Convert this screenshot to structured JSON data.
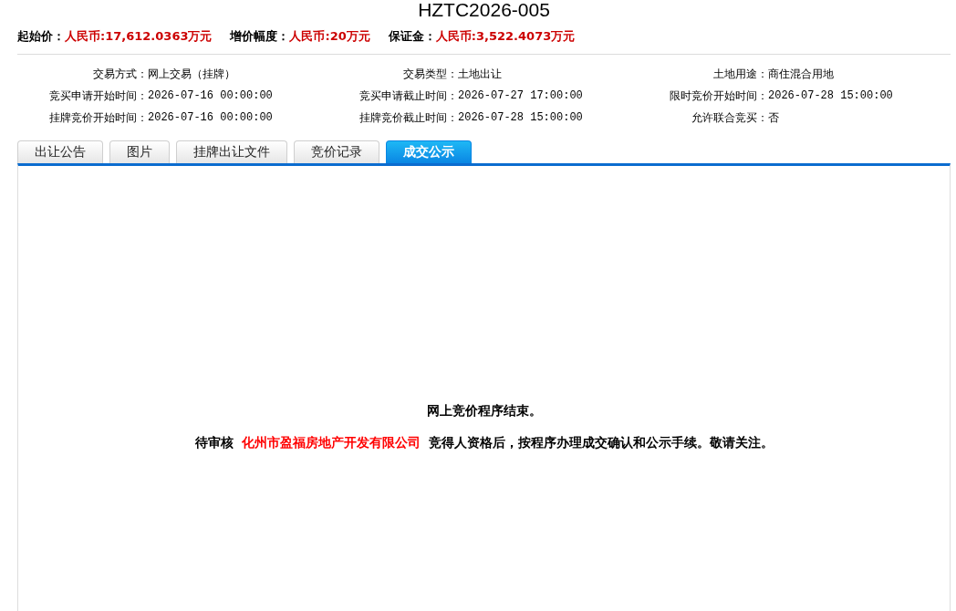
{
  "title": "HZTC2026-005",
  "prices": [
    {
      "label": "起始价：",
      "value": "人民币:17,612.0363万元"
    },
    {
      "label": "增价幅度：",
      "value": "人民币:20万元"
    },
    {
      "label": "保证金：",
      "value": "人民币:3,522.4073万元"
    }
  ],
  "details": [
    {
      "label": "交易方式：",
      "value": "网上交易（挂牌）"
    },
    {
      "label": "交易类型：",
      "value": "土地出让"
    },
    {
      "label": "土地用途：",
      "value": "商住混合用地"
    },
    {
      "label": "竞买申请开始时间：",
      "value": "2026-07-16 00:00:00"
    },
    {
      "label": "竞买申请截止时间：",
      "value": "2026-07-27 17:00:00"
    },
    {
      "label": "限时竞价开始时间：",
      "value": "2026-07-28 15:00:00"
    },
    {
      "label": "挂牌竞价开始时间：",
      "value": "2026-07-16 00:00:00"
    },
    {
      "label": "挂牌竞价截止时间：",
      "value": "2026-07-28 15:00:00"
    },
    {
      "label": "允许联合竞买：",
      "value": "否"
    }
  ],
  "tabs": [
    {
      "label": "出让公告",
      "selected": false
    },
    {
      "label": "图片",
      "selected": false
    },
    {
      "label": "挂牌出让文件",
      "selected": false
    },
    {
      "label": "竞价记录",
      "selected": false
    },
    {
      "label": "成交公示",
      "selected": true
    }
  ],
  "notice": {
    "heading": "网上竞价程序结束。",
    "prefix": "待审核",
    "company": "化州市盈福房地产开发有限公司",
    "suffix": "竞得人资格后，按程序办理成交确认和公示手续。敬请关注。"
  }
}
